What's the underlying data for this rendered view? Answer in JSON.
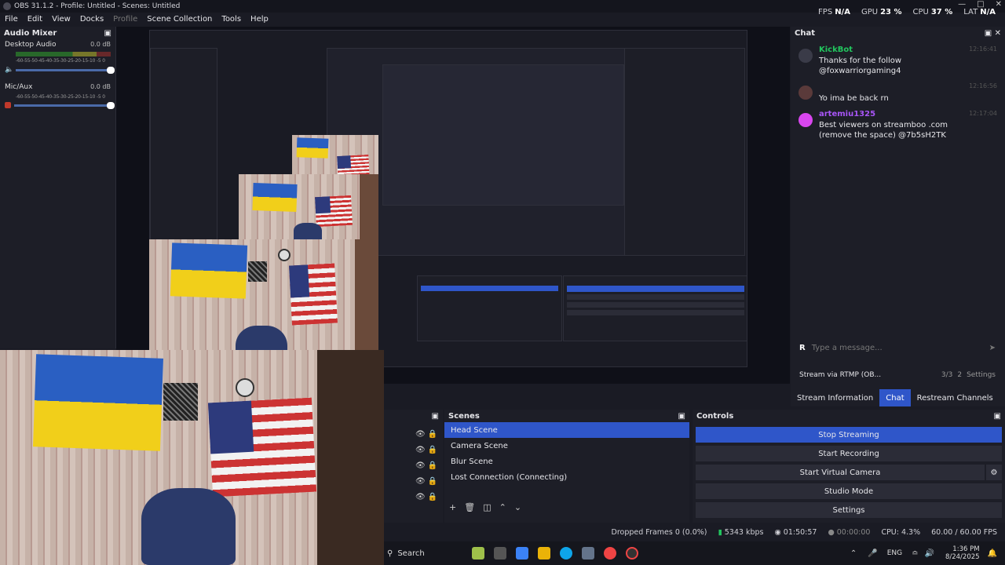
{
  "window": {
    "title": "OBS 31.1.2 - Profile: Untitled - Scenes: Untitled"
  },
  "menu": [
    "File",
    "Edit",
    "View",
    "Docks",
    "Profile",
    "Scene Collection",
    "Tools",
    "Help"
  ],
  "stats": {
    "fps_label": "FPS",
    "fps_value": "N/A",
    "gpu_label": "GPU",
    "gpu_value": "23 %",
    "cpu_label": "CPU",
    "cpu_value": "37 %",
    "lat_label": "LAT",
    "lat_value": "N/A"
  },
  "mixer": {
    "title": "Audio Mixer",
    "channels": [
      {
        "name": "Desktop Audio",
        "db": "0.0 dB"
      },
      {
        "name": "Mic/Aux",
        "db": "0.0 dB"
      }
    ],
    "ticks": "-60-55-50-45-40-35-30-25-20-15-10 -5 0"
  },
  "chat": {
    "title": "Chat",
    "messages": [
      {
        "user": "KickBot",
        "text": "Thanks for the follow @foxwarriorgaming4",
        "time": "12:16:41",
        "color": "#22c55e"
      },
      {
        "user": "",
        "text": "Yo ima be back rn",
        "time": "12:16:56",
        "color": "#a855f7"
      },
      {
        "user": "artemiu1325",
        "text": "Best viewers on streamboo .com (remove the space) @7b5sH2TK",
        "time": "12:17:04",
        "color": "#a855f7"
      }
    ],
    "input_placeholder": "Type a message...",
    "stream_label": "Stream via RTMP (OB...",
    "viewers": "3/3",
    "watching": "2",
    "settings": "Settings"
  },
  "tabs": [
    "Stream Information",
    "Chat",
    "Restream Channels"
  ],
  "scenes": {
    "title": "Scenes",
    "items": [
      "Head Scene",
      "Camera Scene",
      "Blur Scene",
      "Lost Connection (Connecting)"
    ]
  },
  "controls": {
    "title": "Controls",
    "buttons": [
      "Stop Streaming",
      "Start Recording",
      "Start Virtual Camera",
      "Studio Mode",
      "Settings"
    ]
  },
  "status": {
    "dropped": "Dropped Frames 0 (0.0%)",
    "kbps": "5343 kbps",
    "live": "01:50:57",
    "rec": "00:00:00",
    "cpu": "CPU: 4.3%",
    "fps": "60.00 / 60.00 FPS"
  },
  "taskbar": {
    "search": "Search",
    "lang": "ENG",
    "time": "1:36 PM",
    "date": "8/24/2025"
  },
  "colors": {
    "accent": "#2f56c9",
    "bg": "#1a1b24",
    "panel": "#1d1e27"
  }
}
